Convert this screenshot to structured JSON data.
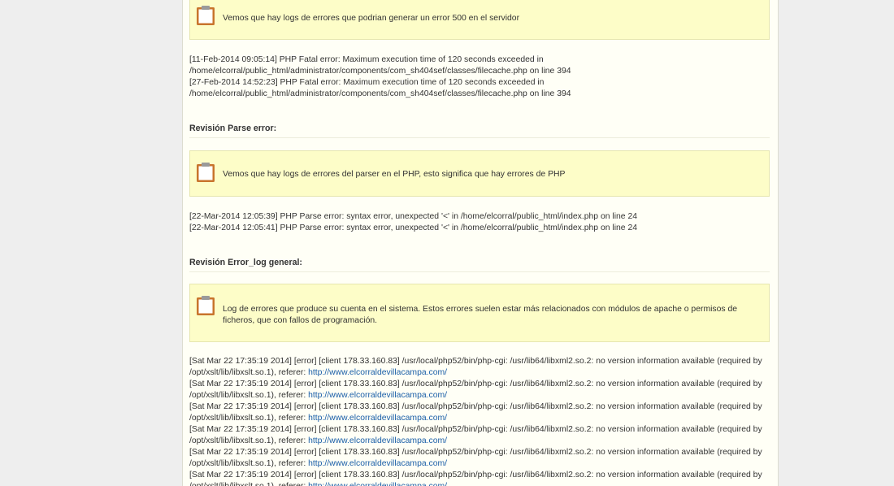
{
  "sections": [
    {
      "note": "Vemos que hay logs de errores que podrian generar un error 500 en el servidor",
      "logs": [
        "[11-Feb-2014 09:05:14] PHP Fatal error: Maximum execution time of 120 seconds exceeded in /home/elcorral/public_html/administrator/components/com_sh404sef/classes/filecache.php on line 394",
        "[27-Feb-2014 14:52:23] PHP Fatal error: Maximum execution time of 120 seconds exceeded in /home/elcorral/public_html/administrator/components/com_sh404sef/classes/filecache.php on line 394"
      ]
    },
    {
      "heading": "Revisión Parse error:",
      "note": "Vemos que hay logs de errores del parser en el PHP, esto significa que hay errores de PHP",
      "logs": [
        "[22-Mar-2014 12:05:39] PHP Parse error: syntax error, unexpected '<' in /home/elcorral/public_html/index.php on line 24",
        "[22-Mar-2014 12:05:41] PHP Parse error: syntax error, unexpected '<' in /home/elcorral/public_html/index.php on line 24"
      ]
    },
    {
      "heading": "Revisión Error_log general:",
      "note": "Log de errores que produce su cuenta en el sistema. Estos errores suelen estar más relacionados con módulos de apache o permisos de ficheros, que con fallos de programación.",
      "log_prefix": "[Sat Mar 22 17:35:19 2014] [error] [client 178.33.160.83] /usr/local/php52/bin/php-cgi: /usr/lib64/libxml2.so.2: no version information available (required by /opt/xslt/lib/libxslt.so.1), referer:",
      "log_link": "http://www.elcorraldevillacampa.com/"
    }
  ]
}
